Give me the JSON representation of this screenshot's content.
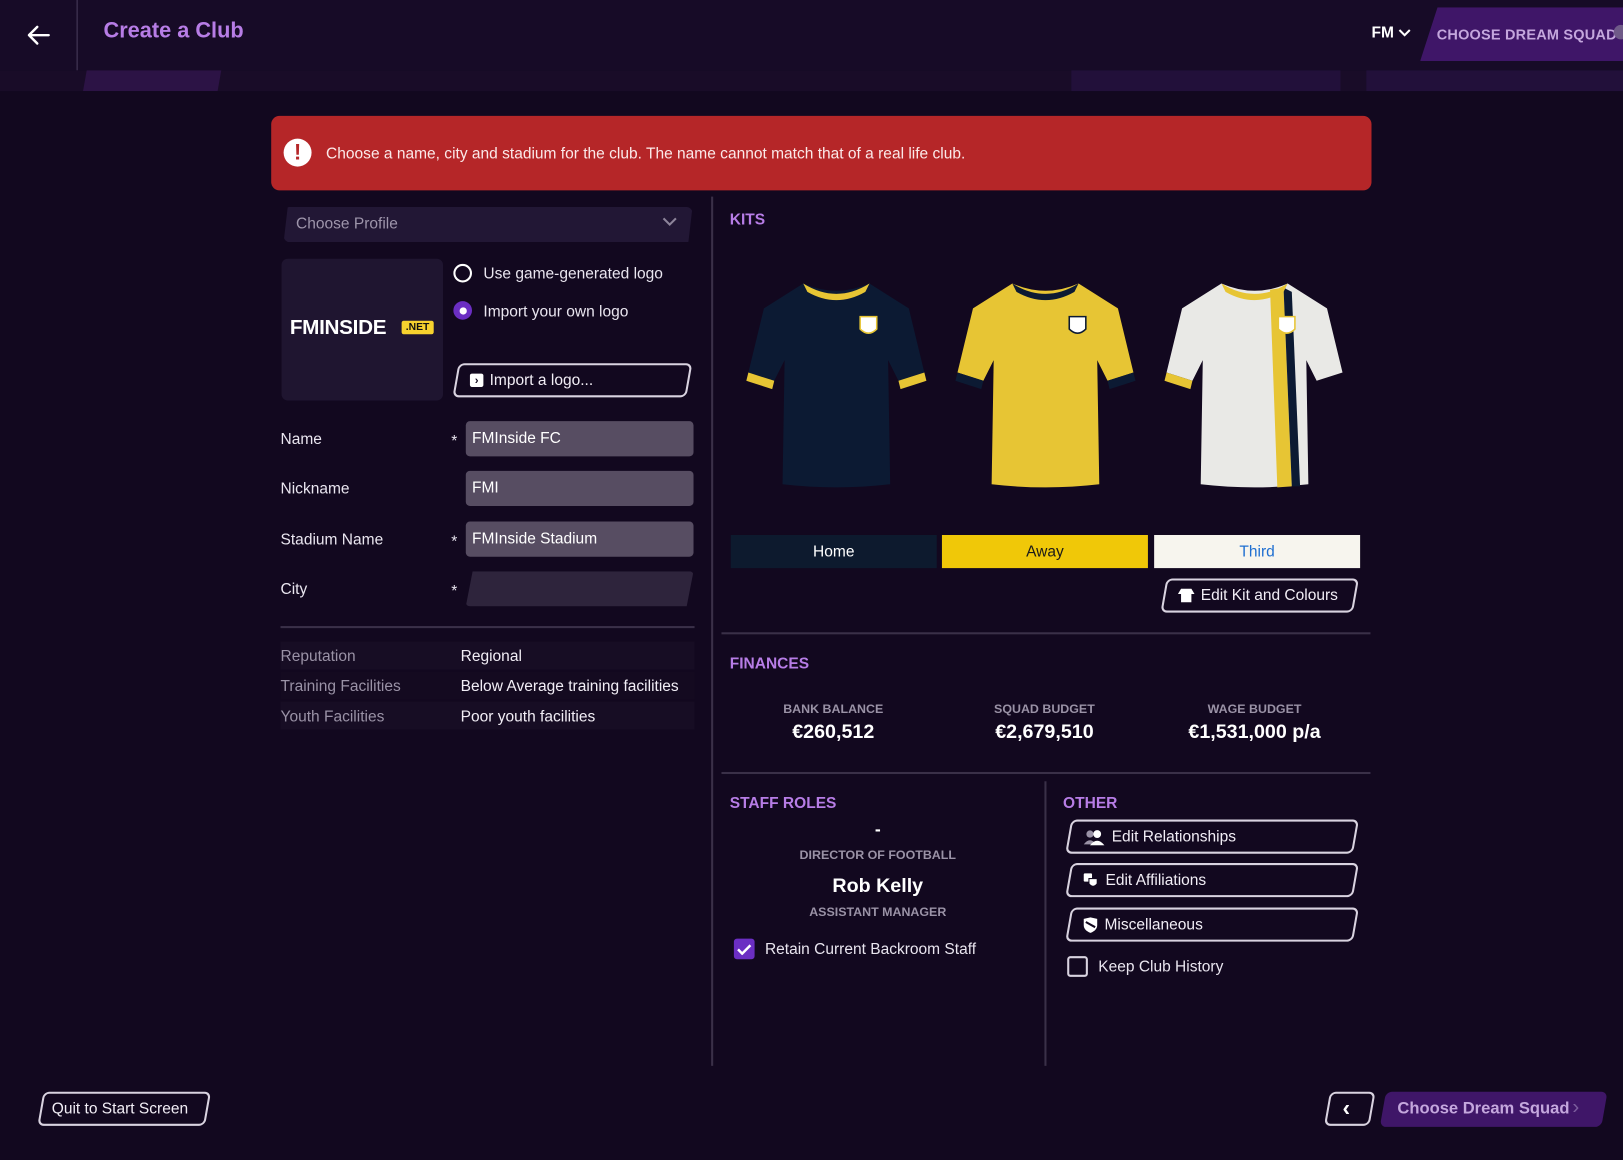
{
  "header": {
    "title": "Create a Club",
    "fm_menu_label": "FM",
    "breadcrumb_tab": "CHOOSE DREAM SQUAD"
  },
  "banner": {
    "message": "Choose a name, city and stadium for the club. The name cannot match that of a real life club.",
    "icon": "!"
  },
  "profile": {
    "placeholder": "Choose Profile"
  },
  "logo": {
    "text": "FMINSIDE",
    "badge": ".NET",
    "options": [
      {
        "label": "Use game-generated logo",
        "selected": false
      },
      {
        "label": "Import your own logo",
        "selected": true
      }
    ],
    "import_button": "Import a logo..."
  },
  "form": {
    "fields": [
      {
        "label": "Name",
        "required": true,
        "value": "FMInside FC"
      },
      {
        "label": "Nickname",
        "required": false,
        "value": "FMI"
      },
      {
        "label": "Stadium Name",
        "required": true,
        "value": "FMInside Stadium"
      },
      {
        "label": "City",
        "required": true,
        "value": ""
      }
    ],
    "required_marker": "*"
  },
  "info": [
    {
      "label": "Reputation",
      "value": "Regional"
    },
    {
      "label": "Training Facilities",
      "value": "Below Average training facilities"
    },
    {
      "label": "Youth Facilities",
      "value": "Poor youth facilities"
    }
  ],
  "kits": {
    "title": "KITS",
    "tabs": [
      {
        "label": "Home",
        "bg": "#0d1a2e",
        "fg": "#ffffff"
      },
      {
        "label": "Away",
        "bg": "#f0c808",
        "fg": "#1a1a1a"
      },
      {
        "label": "Third",
        "bg": "#f7f5ee",
        "fg": "#1f6fd1"
      }
    ],
    "shirts": [
      {
        "name": "home",
        "body": "#0c1a33",
        "trim": "#e7c534"
      },
      {
        "name": "away",
        "body": "#e7c534",
        "trim": "#0c1a33"
      },
      {
        "name": "third",
        "body": "#e9e9e6",
        "trim": "#e7c534",
        "stripe1": "#e7c534",
        "stripe2": "#0c1a33"
      }
    ],
    "edit_button": "Edit Kit and Colours"
  },
  "finances": {
    "title": "FINANCES",
    "items": [
      {
        "label": "BANK BALANCE",
        "value": "€260,512"
      },
      {
        "label": "SQUAD BUDGET",
        "value": "€2,679,510"
      },
      {
        "label": "WAGE BUDGET",
        "value": "€1,531,000 p/a"
      }
    ]
  },
  "staff": {
    "title": "STAFF ROLES",
    "roles": [
      {
        "name": "-",
        "role": "DIRECTOR OF FOOTBALL"
      },
      {
        "name": "Rob Kelly",
        "role": "ASSISTANT MANAGER"
      }
    ],
    "retain_label": "Retain Current Backroom Staff",
    "retain_checked": true
  },
  "other": {
    "title": "OTHER",
    "buttons": [
      "Edit Relationships",
      "Edit Affiliations",
      "Miscellaneous"
    ],
    "keep_history_label": "Keep Club History",
    "keep_history_checked": false
  },
  "footer": {
    "quit_label": "Quit to Start Screen",
    "prev_icon": "‹",
    "next_label": "Choose Dream Squad",
    "next_icon": "›"
  },
  "colors": {
    "accent": "#b77de6",
    "primary": "#3f1668",
    "banner": "#b52628",
    "background": "#12081f"
  }
}
